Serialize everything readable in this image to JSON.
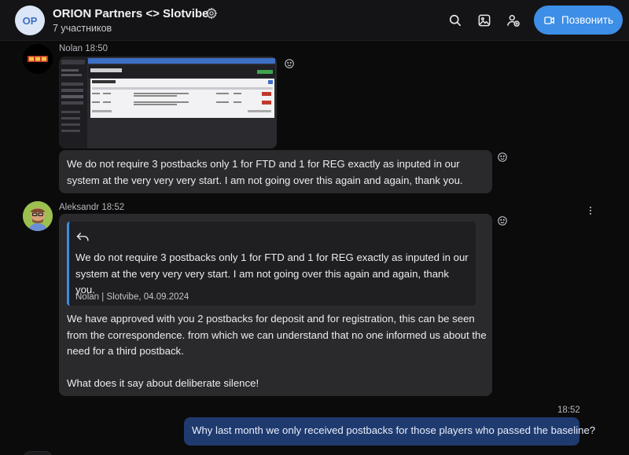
{
  "header": {
    "avatar_initials": "OP",
    "title": "ORION Partners <> Slotvibe",
    "members": "7 участников",
    "call_label": "Позвонить"
  },
  "messages": [
    {
      "sender": "Nolan 18:50",
      "avatar_label": "SLOTVIBE",
      "text": "We do not require 3 postbacks only 1 for FTD and 1 for REG exactly as inputed in our system at the very very very start. I am not going over this again and again, thank you."
    },
    {
      "sender": "Aleksandr 18:52",
      "quote_text": "We do not require 3 postbacks only 1 for FTD and 1 for REG exactly as inputed in our system at the very very very start. I am not going over this again and again, thank you.",
      "quote_meta": "Nolan | Slotvibe, 04.09.2024",
      "text_1": "We have approved with you 2 postbacks for deposit and for registration, this can be seen from the correspondence. from which we can understand that no one informed us about the need for a third postback.",
      "text_2": "What does it say about deliberate silence!"
    },
    {
      "time": "18:52",
      "text": "Why last month we only received postbacks for those players who passed the baseline?"
    }
  ],
  "icons": [
    "settings-icon",
    "search-icon",
    "media-icon",
    "add-member-icon",
    "phone-icon",
    "reaction-icon",
    "reply-icon",
    "more-icon"
  ],
  "colors": {
    "accent": "#3d8ee6",
    "bubble": "#2a2a2d",
    "own_bubble": "#1f3a6e",
    "background": "#0b0b0c"
  }
}
